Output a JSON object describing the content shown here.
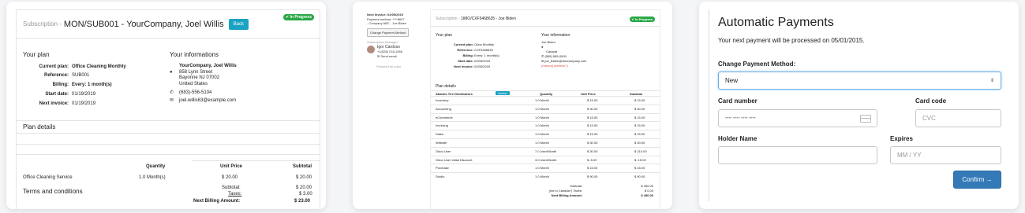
{
  "card1": {
    "subscription_prefix": "Subscription -",
    "subscription_title": "MON/SUB001 - YourCompany, Joel Willis",
    "back_label": "Back",
    "status_badge": "✔ In Progress",
    "plan_heading": "Your plan",
    "plan_rows": [
      {
        "label": "Current plan:",
        "value": "Office Cleaning Monthly"
      },
      {
        "label": "Reference:",
        "value": "SUB001"
      },
      {
        "label": "Billing:",
        "value": "Every: 1 month(s)"
      },
      {
        "label": "Start date:",
        "value": "01/19/2019"
      },
      {
        "label": "Next invoice:",
        "value": "01/19/2019"
      }
    ],
    "info_heading": "Your informations",
    "info": {
      "name": "YourCompany, Joel Willis",
      "street": "858 Lynn Street",
      "city": "Bayonne NJ 07002",
      "country": "United States",
      "phone": "(683)-556-5104",
      "email": "joel.willis63@example.com"
    },
    "details_heading": "Plan details",
    "table": {
      "headers": [
        "Quantity",
        "Unit Price",
        "Subtotal"
      ],
      "row": {
        "product": "Office Cleaning Service",
        "quantity": "1.0 Month(s)",
        "unit_price": "$ 20.00",
        "subtotal": "$ 20.00"
      }
    },
    "totals": [
      {
        "label": "Subtotal:",
        "value": "$ 20.00"
      },
      {
        "label": "Taxes:",
        "value": "$ 3.00"
      },
      {
        "label": "Next Billing Amount:",
        "value": "$ 23.00"
      }
    ],
    "terms_heading": "Terms and conditions"
  },
  "card2": {
    "side": {
      "next_invoice": "Next Invoice: 02/05/2019",
      "payment_method": "Payment method: ****6697",
      "company_line": "- Company ABC - Joe Biden",
      "change_button": "Change Payment Method",
      "manager_label": "Subscription Manager:",
      "manager_name": "Igor Cardoso",
      "manager_phone": "+1(528) 218-1066",
      "send_email": "Send email",
      "powered_by": "Powered by odoo"
    },
    "subscription_prefix": "Subscription -",
    "subscription_title": "1IMO/CXF5468635 - Joe Biden",
    "status_badge": "✔ In Progress",
    "plan_heading": "Your plan",
    "plan_rows": [
      {
        "label": "Current plan:",
        "value": "Odoo Monthly"
      },
      {
        "label": "Reference:",
        "value": "CXF5468635"
      },
      {
        "label": "Billing:",
        "value": "Every: 1 month(s)"
      },
      {
        "label": "Start date:",
        "value": "02/05/2019"
      },
      {
        "label": "Next invoice:",
        "value": "02/05/2019"
      }
    ],
    "info_heading": "Your information",
    "info": {
      "name": "Joe Biden",
      "country": "Canada",
      "phone": "(555) 555-0000",
      "email": "joe_Biden@abccompany.com",
      "warning": "(missing address?)"
    },
    "details_heading": "Plan details",
    "table_headers": [
      "Atlantic Tire Distributors",
      "review",
      "Quantity",
      "Unit Price",
      "Subtotal"
    ],
    "rows": [
      {
        "product": "Inventory",
        "qty": "1.0 Month",
        "price": "$ 15.00",
        "sub": "$ 15.00"
      },
      {
        "product": "Accounting",
        "qty": "1.0 Month",
        "price": "$ 30.00",
        "sub": "$ 30.00"
      },
      {
        "product": "eCommerce",
        "qty": "1.0 Month",
        "price": "$ 15.00",
        "sub": "$ 15.00"
      },
      {
        "product": "Invoicing",
        "qty": "1.0 Month",
        "price": "$ 15.00",
        "sub": "$ 15.00"
      },
      {
        "product": "Sales",
        "qty": "1.0 Month",
        "price": "$ 15.00",
        "sub": "$ 15.00"
      },
      {
        "product": "Website",
        "qty": "1.0 Month",
        "price": "$ 30.00",
        "sub": "$ 30.00"
      },
      {
        "product": "Odoo User",
        "qty": "7.0 User/Month",
        "price": "$ 30.00",
        "sub": "$ 210.00"
      },
      {
        "product": "Odoo User Initial Discount",
        "qty": "3.0 User/Month",
        "price": "$ -5.00",
        "sub": "$ -15.00"
      },
      {
        "product": "Purchase",
        "qty": "1.0 Month",
        "price": "$ 15.00",
        "sub": "$ 15.00"
      },
      {
        "product": "Studio",
        "qty": "1.0 Month",
        "price": "$ 90.00",
        "sub": "$ 90.00"
      }
    ],
    "totals": [
      {
        "label": "Subtotal:",
        "value": "$ 450.00"
      },
      {
        "label": "(not in Canada?) Taxes:",
        "value": "$ 0.00"
      },
      {
        "label": "Next Billing Amount:",
        "value": "$ 450.00"
      }
    ]
  },
  "card3": {
    "title": "Automatic Payments",
    "text": "Your next payment will be processed on 05/01/2015.",
    "change_label": "Change Payment Method:",
    "select_value": "New",
    "card_number_label": "Card number",
    "card_number_placeholder": "•••• •••• •••• ••••",
    "card_code_label": "Card code",
    "card_code_placeholder": "CVC",
    "holder_label": "Holder Name",
    "expires_label": "Expires",
    "expires_placeholder": "MM / YY",
    "confirm_label": "Confirm →"
  },
  "colors": {
    "accent": "#1aa3c4",
    "success": "#28a745",
    "primary": "#337ab7",
    "focus": "#66afe9"
  }
}
